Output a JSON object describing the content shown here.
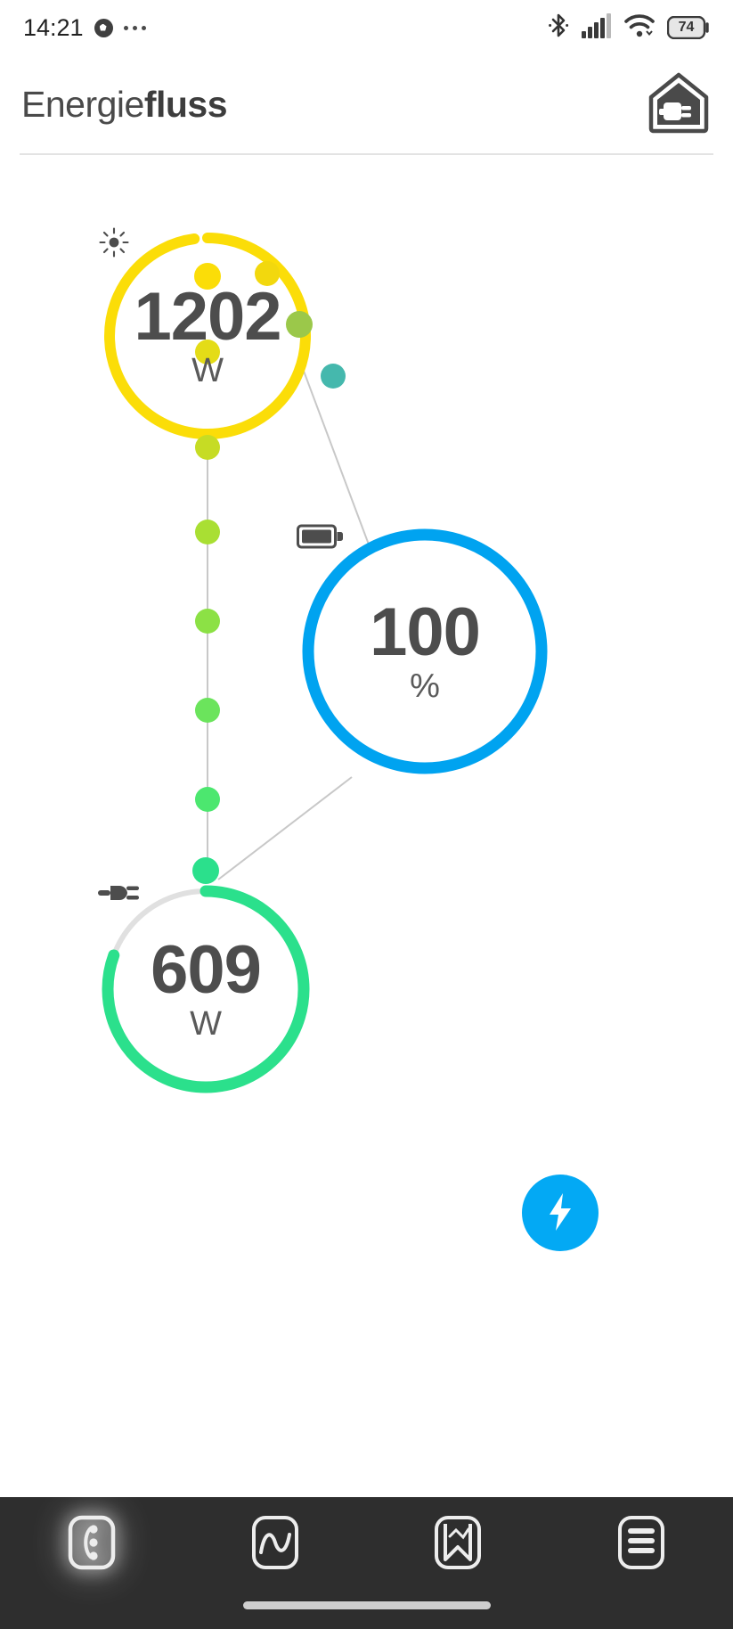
{
  "status_bar": {
    "time": "14:21",
    "ball_icon": "football-icon",
    "more_icon": "more-dots-icon",
    "bluetooth_icon": "bluetooth-icon",
    "signal_icon": "cellular-signal-icon",
    "wifi_icon": "wifi-icon",
    "battery_icon": "battery-icon",
    "battery_level": "74"
  },
  "header": {
    "title_light": "Energie",
    "title_bold": "fluss",
    "action_icon": "house-plug-icon"
  },
  "colors": {
    "solar": "#FBDD08",
    "battery": "#00A3F0",
    "home": "#2BE08C",
    "track": "#DCDCDC",
    "accent": "#03A9F4",
    "value_text": "#4d4d4d",
    "nav_bg": "#2e2e2e"
  },
  "flow": {
    "nodes": [
      {
        "id": "solar",
        "name": "solar-node",
        "glyph": "sun-icon",
        "value": "1202",
        "unit": "W",
        "ring_color": "#FBDD08",
        "ring_progress_deg": 352
      },
      {
        "id": "battery",
        "name": "battery-node",
        "glyph": "battery-full-icon",
        "value": "100",
        "unit": "%",
        "ring_color": "#00A3F0",
        "ring_progress_deg": 360
      },
      {
        "id": "home",
        "name": "home-consumption-node",
        "glyph": "plug-icon",
        "value": "609",
        "unit": "W",
        "ring_color": "#2BE08C",
        "ring_progress_deg": 290
      }
    ],
    "links": [
      {
        "name": "solar-to-home-link",
        "from": "solar",
        "to": "home",
        "dot_colors": [
          "#FBDD08",
          "#E4DC17",
          "#BCDC2B",
          "#96E03B",
          "#6FE358",
          "#4FE767",
          "#2BE08C"
        ]
      },
      {
        "name": "solar-to-battery-link",
        "from": "solar",
        "to": "battery",
        "dot_colors": [
          "#F2D80E",
          "#9BC84A",
          "#45B8AD"
        ]
      },
      {
        "name": "battery-to-home-link",
        "from": "battery",
        "to": "home",
        "dot_colors": []
      }
    ]
  },
  "fab": {
    "name": "charge-fab",
    "icon": "lightning-bolt-icon",
    "color": "#03A9F4"
  },
  "bottom_nav": {
    "items": [
      {
        "name": "nav-energy-flow",
        "icon": "energy-flow-icon",
        "active": true
      },
      {
        "name": "nav-live-chart",
        "icon": "sine-wave-icon",
        "active": false
      },
      {
        "name": "nav-statistics",
        "icon": "ribbon-chart-icon",
        "active": false
      },
      {
        "name": "nav-menu",
        "icon": "list-menu-icon",
        "active": false
      }
    ]
  }
}
